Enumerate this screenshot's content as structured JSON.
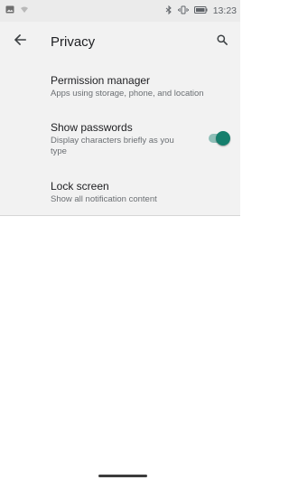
{
  "status_bar": {
    "time": "13:23",
    "icons_left": [
      "image-icon",
      "signal-icon"
    ],
    "icons_right": [
      "bluetooth-icon",
      "vibrate-icon",
      "battery-icon"
    ]
  },
  "app_bar": {
    "title": "Privacy",
    "back_icon": "arrow-back-icon",
    "search_icon": "search-icon"
  },
  "preferences": [
    {
      "title": "Permission manager",
      "summary": "Apps using storage, phone, and location"
    },
    {
      "title": "Show passwords",
      "summary": "Display characters briefly as you type",
      "toggle_on": true
    },
    {
      "title": "Lock screen",
      "summary": "Show all notification content"
    }
  ],
  "colors": {
    "accent": "#167f6d",
    "accent_track": "#8fbfb8",
    "app_bar_bg": "#f2f2f2",
    "status_bar_bg": "#ebebeb"
  }
}
